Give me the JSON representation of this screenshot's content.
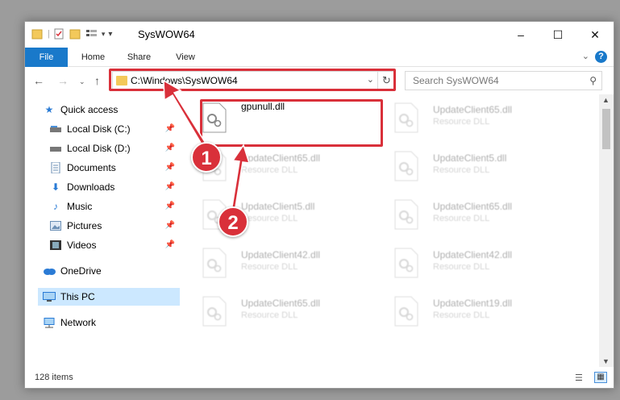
{
  "window": {
    "title": "SysWOW64",
    "controls": {
      "minimize": "–",
      "maximize": "☐",
      "close": "✕"
    }
  },
  "ribbon": {
    "tabs": [
      {
        "label": "File",
        "active": true
      },
      {
        "label": "Home"
      },
      {
        "label": "Share"
      },
      {
        "label": "View"
      }
    ],
    "help": "?"
  },
  "address": {
    "path": "C:\\Windows\\SysWOW64",
    "search_placeholder": "Search SysWOW64"
  },
  "navpane": {
    "items": [
      {
        "label": "Quick access",
        "icon": "star-icon"
      },
      {
        "label": "Local Disk (C:)",
        "icon": "drive-icon",
        "pinned": true
      },
      {
        "label": "Local Disk (D:)",
        "icon": "drive-icon",
        "pinned": true
      },
      {
        "label": "Documents",
        "icon": "document-icon",
        "pinned": true
      },
      {
        "label": "Downloads",
        "icon": "download-icon",
        "pinned": true
      },
      {
        "label": "Music",
        "icon": "music-icon",
        "pinned": true
      },
      {
        "label": "Pictures",
        "icon": "picture-icon",
        "pinned": true
      },
      {
        "label": "Videos",
        "icon": "video-icon",
        "pinned": true
      },
      {
        "label": "OneDrive",
        "icon": "cloud-icon"
      },
      {
        "label": "This PC",
        "icon": "computer-icon",
        "selected": true
      },
      {
        "label": "Network",
        "icon": "network-icon"
      }
    ]
  },
  "files": [
    {
      "name": "gpunull.dll",
      "type": ""
    },
    {
      "name": "UpdateClient65.dll",
      "type": "Resource DLL"
    },
    {
      "name": "UpdateClient65.dll",
      "type": "Resource DLL"
    },
    {
      "name": "UpdateClient5.dll",
      "type": "Resource DLL"
    },
    {
      "name": "UpdateClient5.dll",
      "type": "Resource DLL"
    },
    {
      "name": "UpdateClient65.dll",
      "type": "Resource DLL"
    },
    {
      "name": "UpdateClient42.dll",
      "type": "Resource DLL"
    },
    {
      "name": "UpdateClient42.dll",
      "type": "Resource DLL"
    },
    {
      "name": "UpdateClient65.dll",
      "type": "Resource DLL"
    },
    {
      "name": "UpdateClient19.dll",
      "type": "Resource DLL"
    }
  ],
  "status": {
    "count": "128 items"
  },
  "annotations": {
    "step1": "1",
    "step2": "2",
    "color": "#d9303a"
  }
}
